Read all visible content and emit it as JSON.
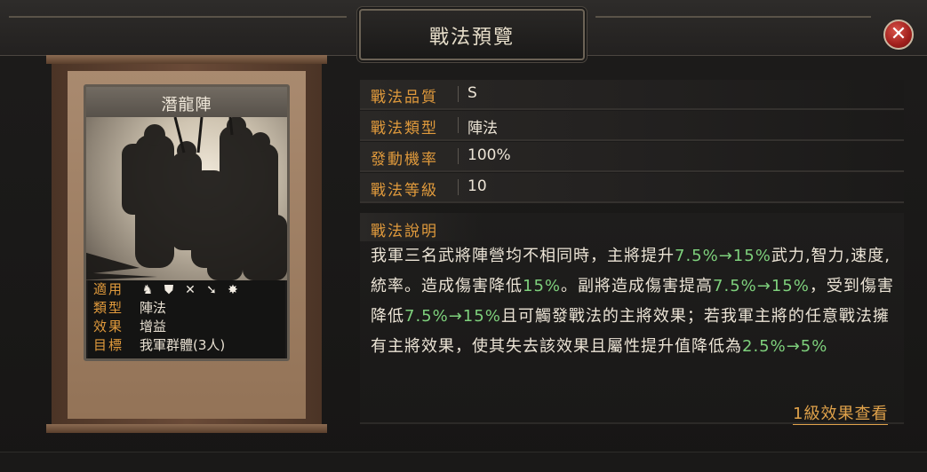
{
  "window": {
    "title": "戰法預覽",
    "close_glyph": "✕"
  },
  "card": {
    "name": "潛龍陣",
    "stats": {
      "suitable_label": "適用",
      "suitable_icons": [
        "cavalry-icon",
        "shield-icon",
        "bow-icon",
        "spear-icon",
        "siege-icon"
      ],
      "type_label": "類型",
      "type_value": "陣法",
      "effect_label": "效果",
      "effect_value": "增益",
      "target_label": "目標",
      "target_value": "我軍群體(3人)"
    }
  },
  "info": [
    {
      "label": "戰法品質",
      "value": "S"
    },
    {
      "label": "戰法類型",
      "value": "陣法"
    },
    {
      "label": "發動機率",
      "value": "100%"
    },
    {
      "label": "戰法等級",
      "value": "10"
    }
  ],
  "description": {
    "title": "戰法說明",
    "segments": [
      {
        "text": "我軍三名武將陣營均不相同時，主將提升",
        "hl": false
      },
      {
        "text": "7.5%→15%",
        "hl": true
      },
      {
        "text": "武力,智力,速度,統率。造成傷害降低",
        "hl": false
      },
      {
        "text": "15%",
        "hl": true
      },
      {
        "text": "。副將造成傷害提高",
        "hl": false
      },
      {
        "text": "7.5%→15%",
        "hl": true
      },
      {
        "text": "，受到傷害降低",
        "hl": false
      },
      {
        "text": "7.5%→15%",
        "hl": true
      },
      {
        "text": "且可觸發戰法的主將效果；若我軍主將的任意戰法擁有主將效果，使其失去該效果且屬性提升值降低為",
        "hl": false
      },
      {
        "text": "2.5%→5%",
        "hl": true
      }
    ]
  },
  "level_link": "1級效果查看",
  "colors": {
    "accent": "#e09a3c",
    "highlight": "#7ed07c",
    "text": "#ece4d6"
  }
}
